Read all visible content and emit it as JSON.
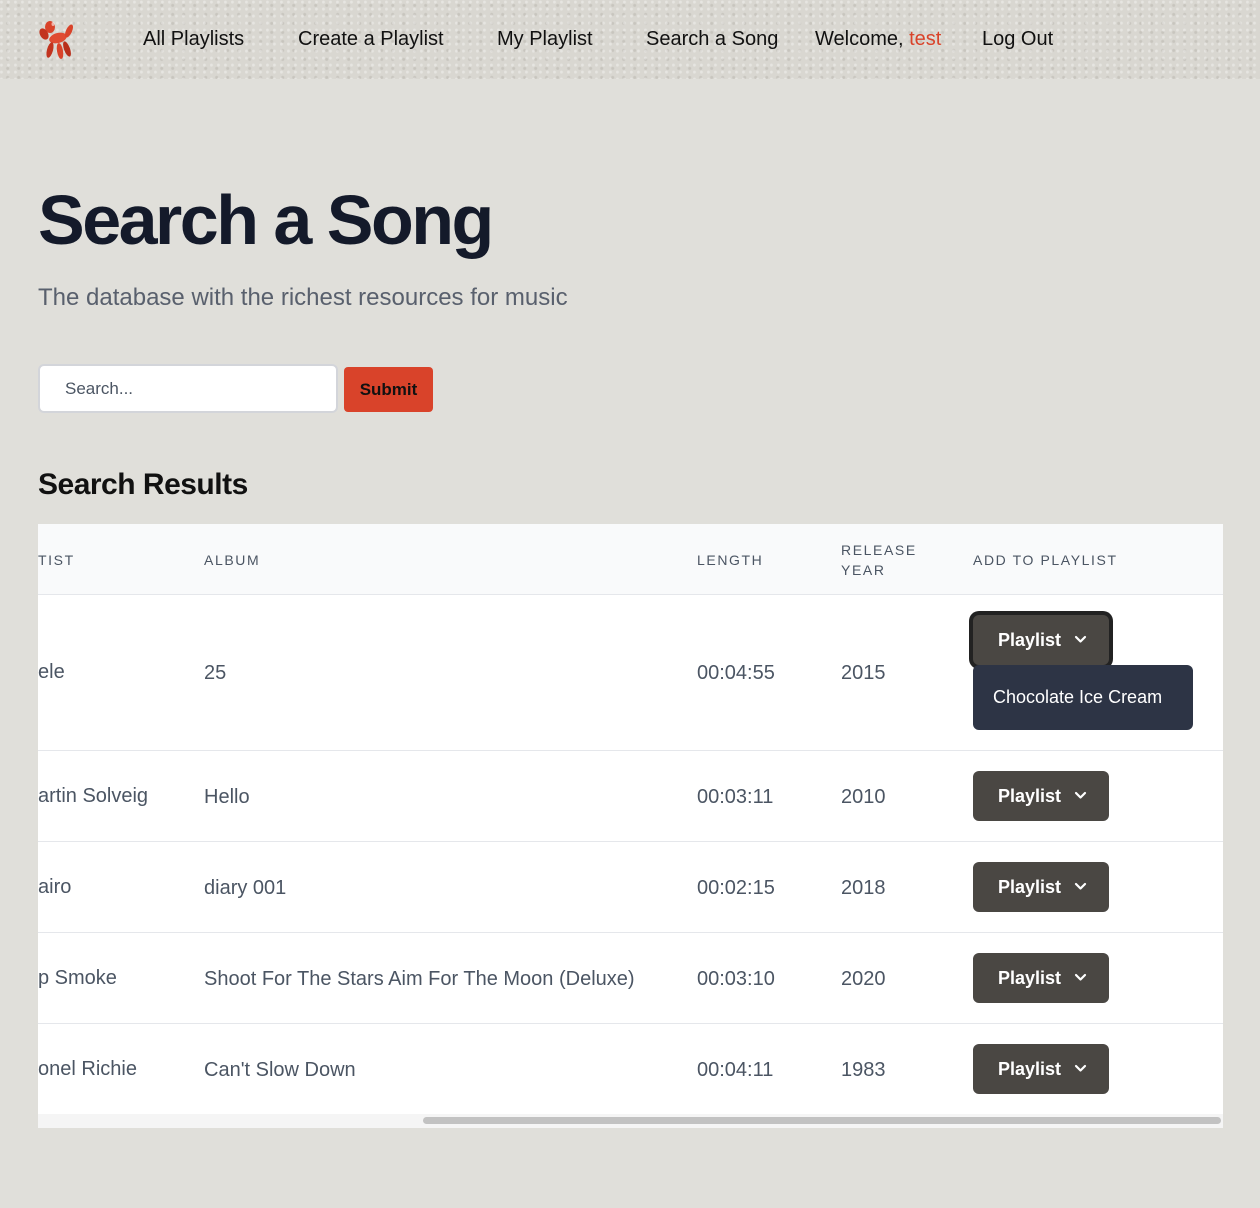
{
  "nav": {
    "links": [
      "All Playlists",
      "Create a Playlist",
      "My Playlist",
      "Search a Song"
    ],
    "welcome_prefix": "Welcome,",
    "username": "test",
    "logout": "Log Out"
  },
  "hero": {
    "title": "Search a Song",
    "subtitle": "The database with the richest resources for music"
  },
  "search": {
    "placeholder": "Search...",
    "value": "",
    "submit_label": "Submit"
  },
  "results": {
    "heading": "Search Results",
    "columns": [
      "TIST",
      "ALBUM",
      "LENGTH",
      "RELEASE",
      "YEAR",
      "ADD TO PLAYLIST"
    ],
    "rows": [
      {
        "artist": "ele",
        "album": "25",
        "length": "00:04:55",
        "year": "2015",
        "button": "Playlist"
      },
      {
        "artist": "artin Solveig",
        "album": "Hello",
        "length": "00:03:11",
        "year": "2010",
        "button": "Playlist"
      },
      {
        "artist": "airo",
        "album": "diary 001",
        "length": "00:02:15",
        "year": "2018",
        "button": "Playlist"
      },
      {
        "artist": "p Smoke",
        "album": "Shoot For The Stars Aim For The Moon (Deluxe)",
        "length": "00:03:10",
        "year": "2020",
        "button": "Playlist"
      },
      {
        "artist": "onel Richie",
        "album": "Can't Slow Down",
        "length": "00:04:11",
        "year": "1983",
        "button": "Playlist"
      }
    ],
    "dropdown_items": [
      "Chocolate Ice Cream"
    ]
  },
  "colors": {
    "accent": "#d9432a",
    "button_dark": "#4a4743",
    "dropdown_bg": "#2d3445",
    "page_bg": "#e0dfda"
  },
  "icons": {
    "logo": "balloon-dog-logo",
    "chevron": "chevron-down-icon"
  }
}
